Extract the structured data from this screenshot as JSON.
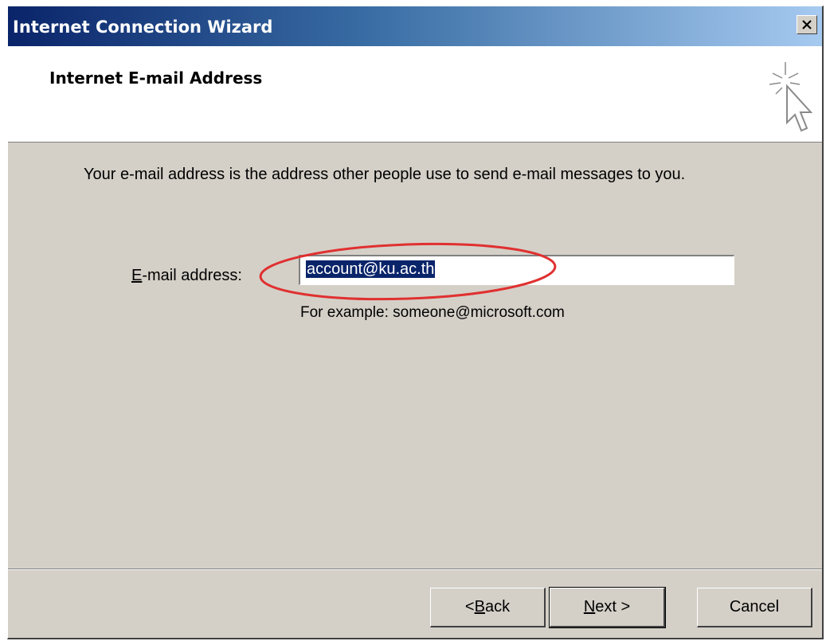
{
  "window": {
    "title": "Internet Connection Wizard"
  },
  "header": {
    "title": "Internet E-mail Address",
    "icon": "wizard-cursor-icon"
  },
  "main": {
    "description": "Your e-mail address is the address other people use to send e-mail messages to you.",
    "email_label_mnemonic": "E",
    "email_label_rest": "-mail address:",
    "email_value": "account@ku.ac.th",
    "example": "For example: someone@microsoft.com",
    "highlight_color": "#e03030"
  },
  "buttons": {
    "back_prefix": "< ",
    "back_mnemonic": "B",
    "back_rest": "ack",
    "next_mnemonic": "N",
    "next_rest": "ext >",
    "cancel": "Cancel"
  },
  "colors": {
    "titlebar_start": "#0a246a",
    "titlebar_end": "#a6caf0",
    "dialog_bg": "#d4d0c8",
    "selection_bg": "#0a246a"
  }
}
